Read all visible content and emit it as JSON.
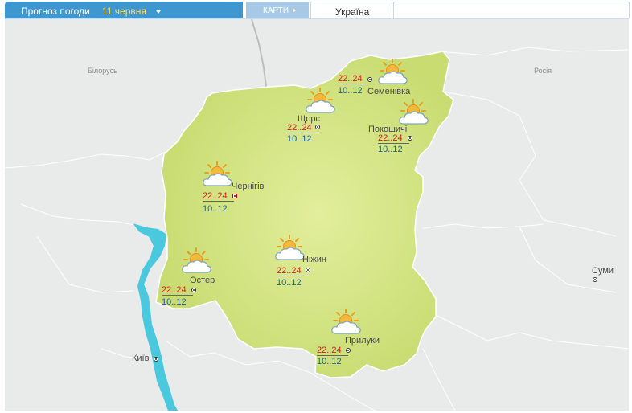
{
  "header": {
    "forecast_label": "Прогноз погоди",
    "date_label": "11 червня",
    "maps_label": "КАРТИ",
    "region_tab": "Україна"
  },
  "map": {
    "countries": {
      "belarus": "Білорусь",
      "russia": "Росія"
    },
    "icon": "sun-behind-cloud-icon",
    "colors": {
      "region": "#cde07a",
      "water": "#4ac8dd",
      "background": "#e9eaea"
    },
    "cities": [
      {
        "name": "Семенівка",
        "max": "22..24",
        "min": "10..12"
      },
      {
        "name": "Щорс",
        "max": "22..24",
        "min": "10..12"
      },
      {
        "name": "Покошичі",
        "max": "22..24",
        "min": "10..12"
      },
      {
        "name": "Чернігів",
        "max": "22..24",
        "min": "10..12"
      },
      {
        "name": "Ніжин",
        "max": "22..24",
        "min": "10..12"
      },
      {
        "name": "Остер",
        "max": "22..24",
        "min": "10..12"
      },
      {
        "name": "Прилуки",
        "max": "22..24",
        "min": "10..12"
      }
    ],
    "other_cities": {
      "kyiv": "Київ",
      "sumy": "Суми"
    }
  }
}
